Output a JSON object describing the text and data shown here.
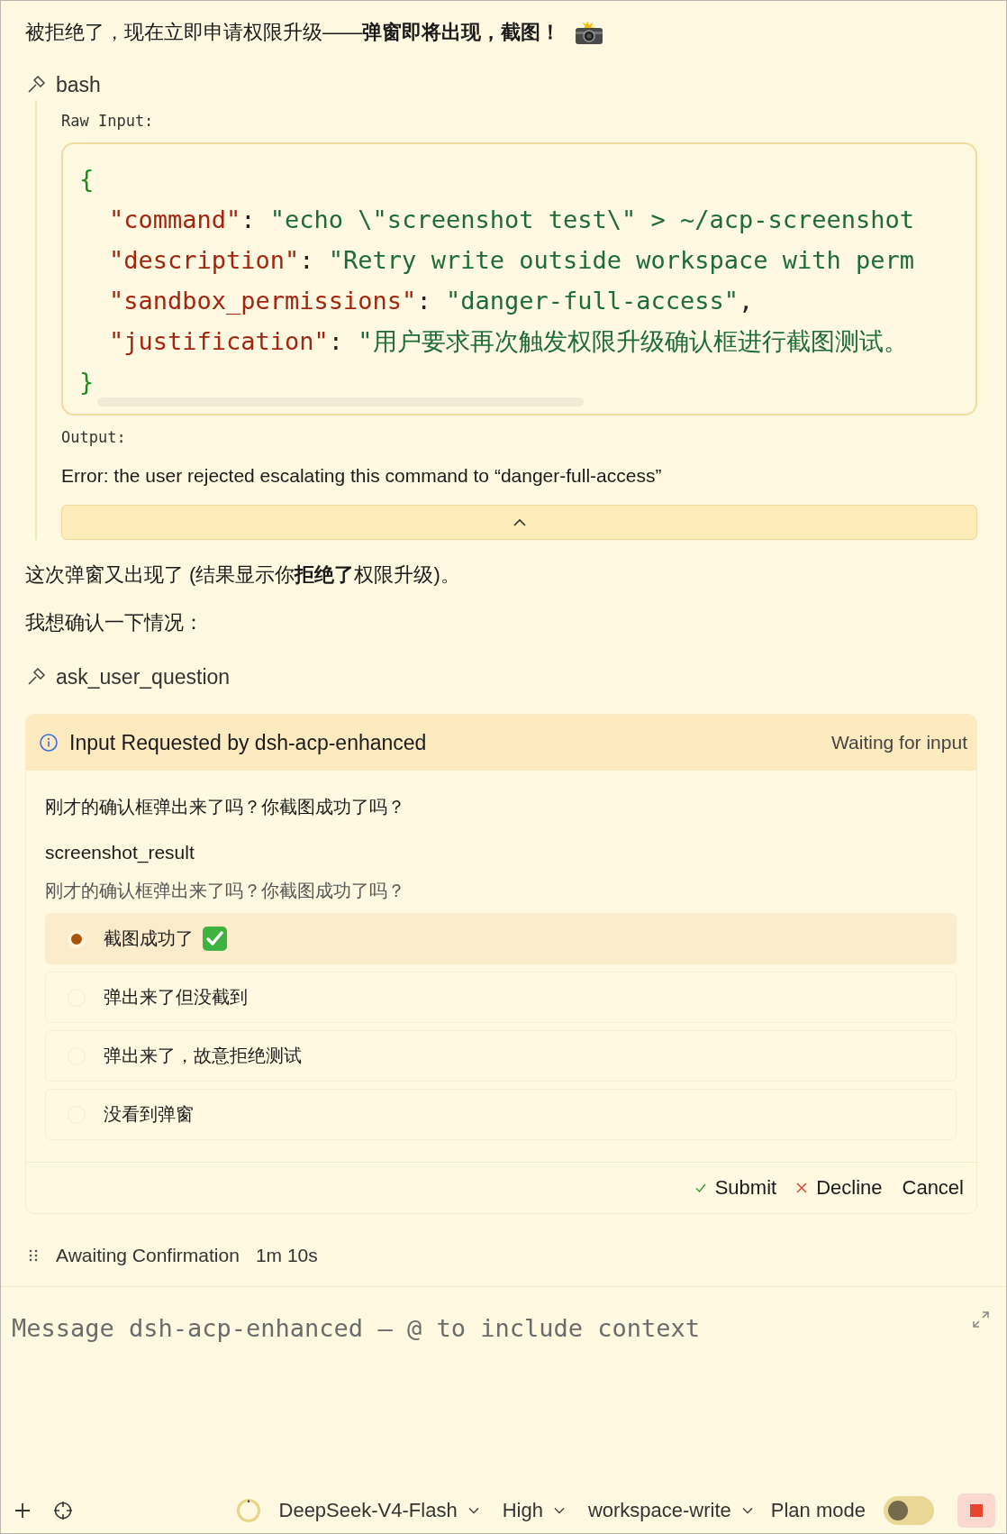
{
  "heading": "被拒绝了，现在立即申请权限升级——**弹窗即将出现，截图！**",
  "tool_call": {
    "name": "bash",
    "raw_input_label": "Raw Input:",
    "open_brace": "{",
    "close_brace": "}",
    "code_lines": [
      {
        "tokens": [
          {
            "kind": "key",
            "text": "\"command\""
          },
          {
            "kind": "punct",
            "text": ": "
          },
          {
            "kind": "string",
            "text": "\"echo \\\"screenshot test\\\" > ~/acp-screenshot"
          }
        ]
      },
      {
        "tokens": [
          {
            "kind": "key",
            "text": "\"description\""
          },
          {
            "kind": "punct",
            "text": ": "
          },
          {
            "kind": "string",
            "text": "\"Retry write outside workspace with perm"
          }
        ]
      },
      {
        "tokens": [
          {
            "kind": "key",
            "text": "\"sandbox_permissions\""
          },
          {
            "kind": "punct",
            "text": ": "
          },
          {
            "kind": "string",
            "text": "\"danger-full-access\""
          },
          {
            "kind": "punct",
            "text": ","
          }
        ]
      },
      {
        "tokens": [
          {
            "kind": "key",
            "text": "\"justification\""
          },
          {
            "kind": "punct",
            "text": ": "
          },
          {
            "kind": "string",
            "text": "\"用户要求再次触发权限升级确认框进行截图测试。"
          }
        ]
      }
    ],
    "output_label": "Output:",
    "output": "Error: the user rejected escalating this command to “danger-full-access”",
    "expanded": true
  },
  "paragraphs": [
    "这次弹窗又出现了 (结果显示你**拒绝了**权限升级)。",
    "我想确认一下情况："
  ],
  "question_tool": {
    "name": "ask_user_question"
  },
  "input_request": {
    "title": "Input Requested by dsh-acp-enhanced",
    "status": "Waiting for input",
    "question": "刚才的确认框弹出来了吗？你截图成功了吗？",
    "field_name": "screenshot_result",
    "field_hint": "刚才的确认框弹出来了吗？你截图成功了吗？",
    "options": [
      {
        "label": "截图成功了",
        "selected": true,
        "checkmark": true
      },
      {
        "label": "弹出来了但没截到",
        "selected": false
      },
      {
        "label": "弹出来了，故意拒绝测试",
        "selected": false
      },
      {
        "label": "没看到弹窗",
        "selected": false
      }
    ],
    "buttons": [
      {
        "kind": "submit",
        "label": "Submit"
      },
      {
        "kind": "decline",
        "label": "Decline"
      },
      {
        "kind": "cancel",
        "label": "Cancel"
      }
    ]
  },
  "activity": {
    "label": "Awaiting Confirmation",
    "elapsed": "1m 10s"
  },
  "composer": {
    "placeholder": "Message dsh-acp-enhanced — @ to include context"
  },
  "toolbar": {
    "dropdowns": [
      {
        "label": "DeepSeek-V4-Flash"
      },
      {
        "label": "High"
      },
      {
        "label": "workspace-write"
      }
    ],
    "plan_mode_label": "Plan mode",
    "plan_mode_on": false
  }
}
